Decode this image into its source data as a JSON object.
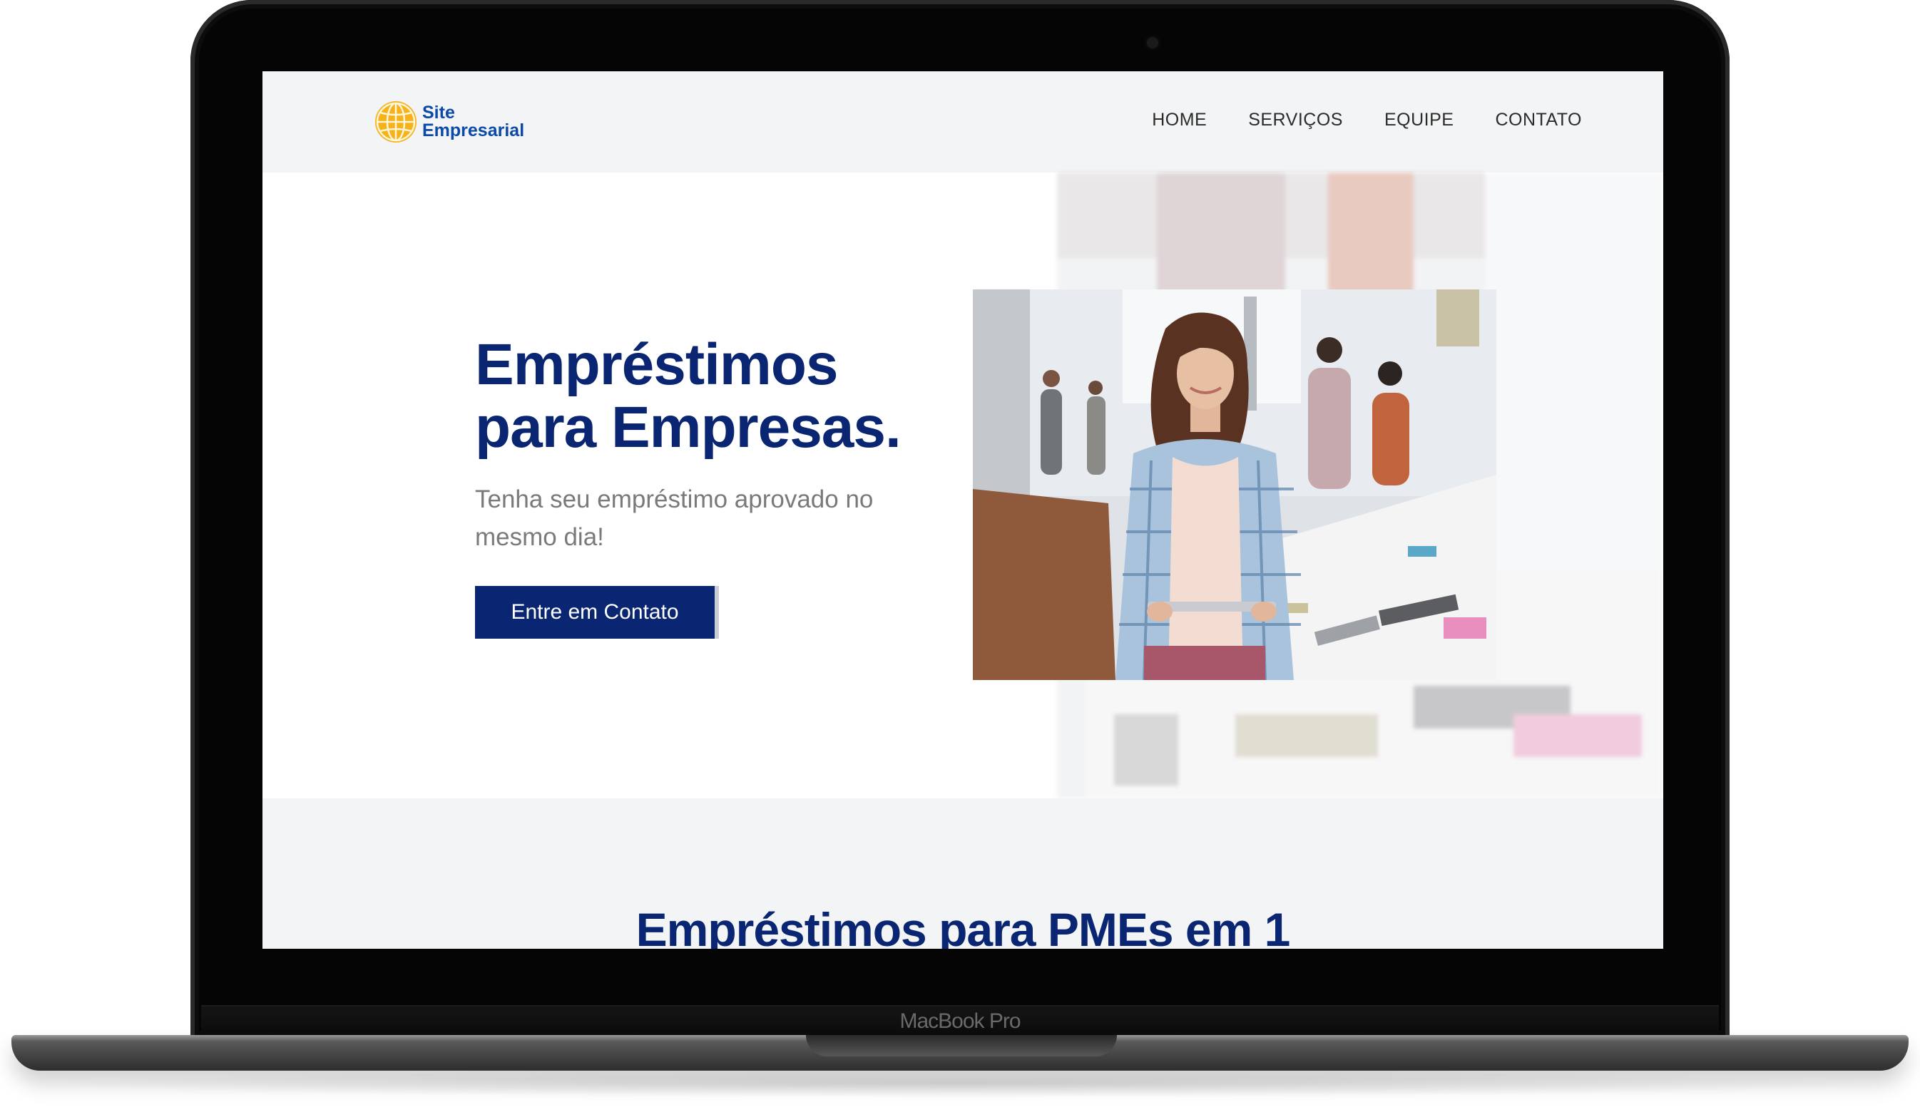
{
  "device": {
    "label": "MacBook Pro"
  },
  "site": {
    "logo": {
      "line1": "Site",
      "line2": "Empresarial",
      "icon": "globe-icon",
      "icon_color": "#f5b21b",
      "text_color": "#0b4aa8"
    },
    "nav": [
      {
        "label": "HOME"
      },
      {
        "label": "SERVIÇOS"
      },
      {
        "label": "EQUIPE"
      },
      {
        "label": "CONTATO"
      }
    ],
    "hero": {
      "title_line1": "Empréstimos",
      "title_line2": "para Empresas.",
      "subtitle": "Tenha seu empréstimo aprovado no mesmo dia!",
      "cta": "Entre em Contato",
      "image": "woman-holding-tablet-in-office-photo"
    },
    "section2": {
      "title": "Empréstimos para PMEs em 1"
    },
    "colors": {
      "primary": "#0a2672",
      "header_bg": "#f3f4f6",
      "subtitle": "#7a7a7a"
    }
  }
}
